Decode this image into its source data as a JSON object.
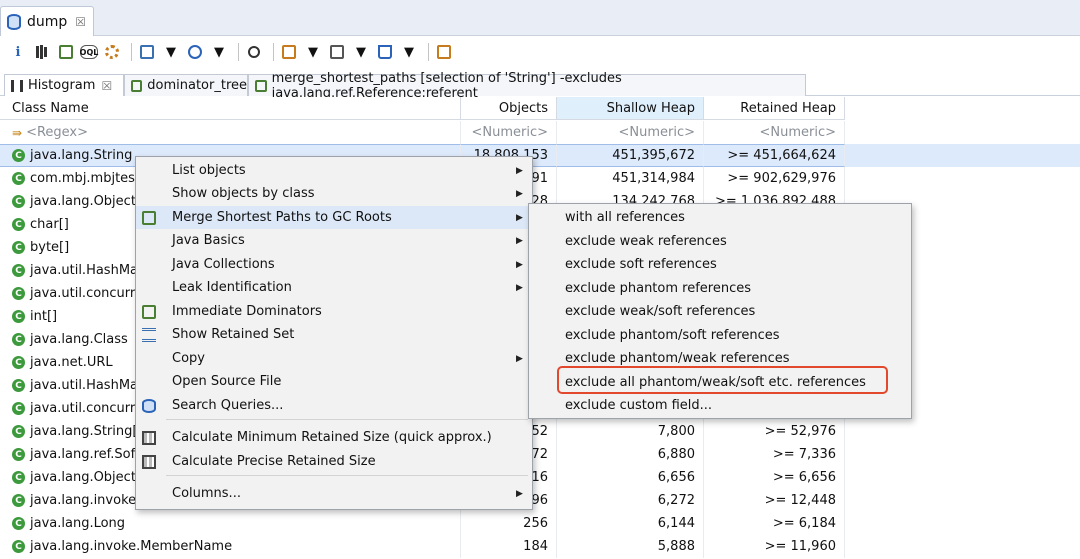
{
  "editor": {
    "tab_label": "dump",
    "close_glyph": "☒"
  },
  "toolbar": {
    "icons": [
      "info-icon",
      "histogram-icon",
      "dominator-tree-icon",
      "oql-icon",
      "gear-icon",
      "report-icon",
      "database-icon",
      "search-icon",
      "group-icon",
      "table-icon",
      "export-icon",
      "leak-suspects-icon"
    ]
  },
  "view_tabs": [
    {
      "label": "Histogram",
      "close": "☒"
    },
    {
      "label": "dominator_tree"
    },
    {
      "label": "merge_shortest_paths [selection of 'String'] -excludes java.lang.ref.Reference:referent"
    }
  ],
  "table": {
    "columns": [
      "Class Name",
      "Objects",
      "Shallow Heap",
      "Retained Heap"
    ],
    "sorted_column": "Shallow Heap",
    "filter_row": {
      "name": "<Regex>",
      "objects": "<Numeric>",
      "shallow": "<Numeric>",
      "retained": "<Numeric>"
    },
    "rows": [
      {
        "name": "java.lang.String",
        "objects": "18,808,153",
        "shallow": "451,395,672",
        "retained": ">= 451,664,624"
      },
      {
        "name": "com.mbj.mbjtest.",
        "objects": "91",
        "shallow": "451,314,984",
        "retained": ">= 902,629,976"
      },
      {
        "name": "java.lang.Object[]",
        "objects": "28",
        "shallow": "134,242,768",
        "retained": ">= 1,036,892,488"
      },
      {
        "name": "char[]",
        "objects": "",
        "shallow": "",
        "retained": ""
      },
      {
        "name": "byte[]",
        "objects": "",
        "shallow": "",
        "retained": ""
      },
      {
        "name": "java.util.HashMap",
        "objects": "",
        "shallow": "",
        "retained": ""
      },
      {
        "name": "java.util.concurre",
        "objects": "",
        "shallow": "",
        "retained": ""
      },
      {
        "name": "int[]",
        "objects": "",
        "shallow": "",
        "retained": ""
      },
      {
        "name": "java.lang.Class",
        "objects": "",
        "shallow": "",
        "retained": ""
      },
      {
        "name": "java.net.URL",
        "objects": "",
        "shallow": "",
        "retained": ""
      },
      {
        "name": "java.util.HashMap",
        "objects": "",
        "shallow": "",
        "retained": ""
      },
      {
        "name": "java.util.concurre",
        "objects": "",
        "shallow": "",
        "retained": ""
      },
      {
        "name": "java.lang.String[]",
        "objects": "52",
        "shallow": "7,800",
        "retained": ">= 52,976"
      },
      {
        "name": "java.lang.ref.Soft",
        "objects": "72",
        "shallow": "6,880",
        "retained": ">= 7,336"
      },
      {
        "name": "java.lang.Object",
        "objects": "16",
        "shallow": "6,656",
        "retained": ">= 6,656"
      },
      {
        "name": "java.lang.invoke.L",
        "objects": "96",
        "shallow": "6,272",
        "retained": ">= 12,448"
      },
      {
        "name": "java.lang.Long",
        "objects": "256",
        "shallow": "6,144",
        "retained": ">= 6,184"
      },
      {
        "name": "java.lang.invoke.MemberName",
        "objects": "184",
        "shallow": "5,888",
        "retained": ">= 11,960"
      }
    ]
  },
  "context_menu": {
    "items": [
      {
        "label": "List objects",
        "submenu": true
      },
      {
        "label": "Show objects by class",
        "submenu": true
      },
      {
        "label": "Merge Shortest Paths to GC Roots",
        "submenu": true,
        "icon": "merge-paths-icon",
        "highlighted": true
      },
      {
        "label": "Java Basics",
        "submenu": true
      },
      {
        "label": "Java Collections",
        "submenu": true
      },
      {
        "label": "Leak Identification",
        "submenu": true
      },
      {
        "label": "Immediate Dominators",
        "icon": "dominators-icon"
      },
      {
        "label": "Show Retained Set",
        "icon": "retained-set-icon"
      },
      {
        "label": "Copy",
        "submenu": true
      },
      {
        "label": "Open Source File"
      },
      {
        "label": "Search Queries...",
        "icon": "search-queries-icon"
      },
      {
        "label": "Calculate Minimum Retained Size (quick approx.)",
        "icon": "calculator-icon"
      },
      {
        "label": "Calculate Precise Retained Size",
        "icon": "calculator-icon"
      },
      {
        "label": "Columns...",
        "submenu": true
      }
    ]
  },
  "submenu": {
    "items": [
      "with all references",
      "exclude weak references",
      "exclude soft references",
      "exclude phantom references",
      "exclude weak/soft references",
      "exclude phantom/soft references",
      "exclude phantom/weak references",
      "exclude all phantom/weak/soft etc. references",
      "exclude custom field..."
    ],
    "boxed_item": "exclude all phantom/weak/soft etc. references"
  },
  "colors": {
    "highlight_border": "#e2492c",
    "selection": "#ddeafc",
    "class_icon": "#3c9a3c"
  }
}
